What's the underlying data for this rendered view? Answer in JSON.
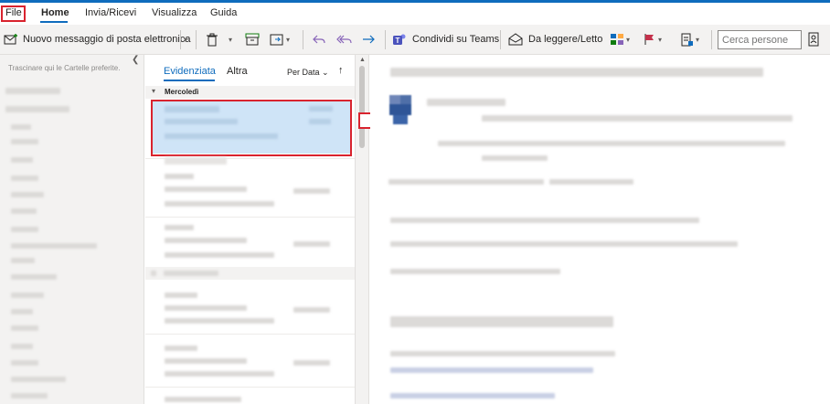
{
  "menu": {
    "tabs": [
      "File",
      "Home",
      "Invia/Ricevi",
      "Visualizza",
      "Guida"
    ],
    "active": "Home"
  },
  "ribbon": {
    "new_message": "Nuovo messaggio di posta elettronica",
    "teams": "Condividi su Teams",
    "read_unread": "Da leggere/Letto",
    "search_people_placeholder": "Cerca persone"
  },
  "folder_pane": {
    "favorites_hint": "Trascinare qui le Cartelle preferite."
  },
  "message_list": {
    "tab_focused": "Evidenziata",
    "tab_other": "Altra",
    "sort_label": "Per Data",
    "sort_direction_icon": "arrow-up-icon",
    "group_label": "Mercoledì"
  },
  "colors": {
    "accent": "#0f6cbd",
    "highlight": "#d9232e",
    "selected_bg": "#cfe4f7",
    "teams": "#4b53bc",
    "flag": "#c4314b"
  }
}
